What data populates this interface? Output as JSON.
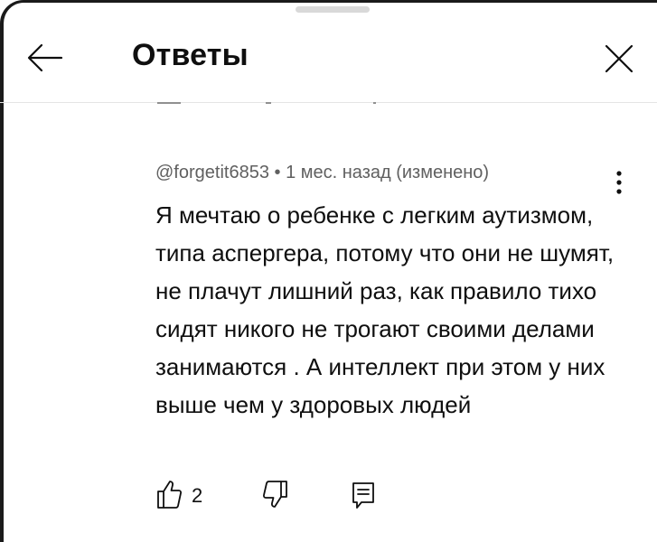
{
  "header": {
    "title": "Ответы",
    "back_icon": "arrow-left-icon",
    "close_icon": "close-icon"
  },
  "comment": {
    "author": "@forgetit6853",
    "separator": "•",
    "time": "1 мес. назад (изменено)",
    "text": "Я мечтаю о ребенке с легким аутизмом, типа аспергера, потому что они не шумят, не плачут лишний раз, как правило тихо сидят никого не трогают своими делами занимаются . А интеллект при этом у них выше чем у здоровых людей",
    "likes": "2",
    "menu_icon": "more-vert-icon",
    "like_icon": "thumb-up-icon",
    "dislike_icon": "thumb-down-icon",
    "reply_icon": "reply-comment-icon"
  },
  "colors": {
    "text": "#0f0f0f",
    "secondary_text": "#606060",
    "divider": "#e5e5e5",
    "handle": "#d9d9d9"
  }
}
